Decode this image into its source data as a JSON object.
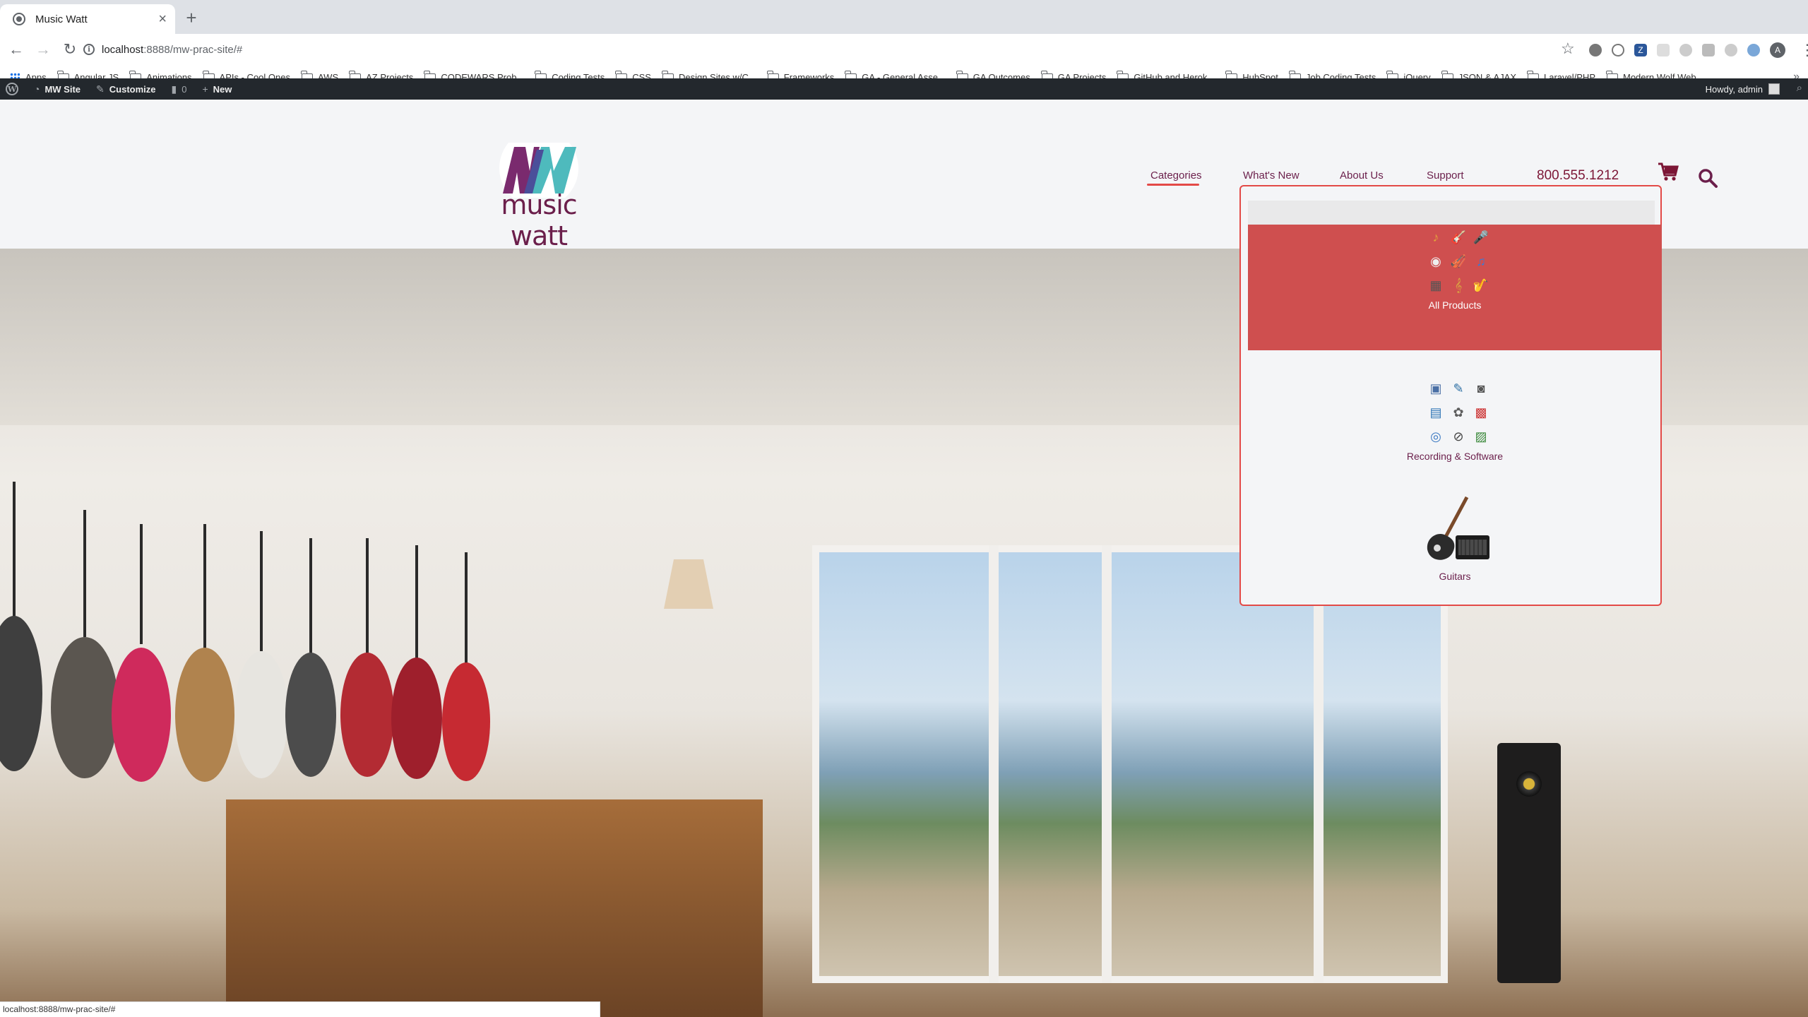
{
  "browser": {
    "tab_title": "Music Watt",
    "new_tab": "+",
    "url_host": "localhost",
    "url_rest": ":8888/mw-prac-site/#",
    "bookmarks": [
      "Apps",
      "Angular JS",
      "Animations",
      "APIs - Cool Ones",
      "AWS",
      "AZ Projects",
      "CODEWARS Prob...",
      "Coding Tests",
      "CSS",
      "Design Sites w/C...",
      "Frameworks",
      "GA - General Asse...",
      "GA Outcomes",
      "GA Projects",
      "GitHub and Herok...",
      "HubSpot",
      "Job Coding Tests",
      "jQuery",
      "JSON & AJAX",
      "Laravel/PHP",
      "Modern Wolf Web..."
    ],
    "profile_initial": "A",
    "status_url": "localhost:8888/mw-prac-site/#"
  },
  "adminbar": {
    "site": "MW Site",
    "customize": "Customize",
    "comments": "0",
    "new": "New",
    "howdy": "Howdy, admin"
  },
  "header": {
    "logo_text": "music watt",
    "nav": [
      "Categories",
      "What's New",
      "About Us",
      "Support"
    ],
    "phone": "800.555.1212"
  },
  "dropdown": {
    "items": [
      {
        "label": "All Products",
        "icon": "instrument-collage"
      },
      {
        "label": "Recording & Software",
        "icon": "software-collage"
      },
      {
        "label": "Guitars",
        "icon": "guitar-and-amp"
      }
    ]
  },
  "colors": {
    "brand": "#6b1f4b",
    "accent": "#e34a47",
    "highlight": "#cf4f4f",
    "adminbar": "#23282d"
  }
}
